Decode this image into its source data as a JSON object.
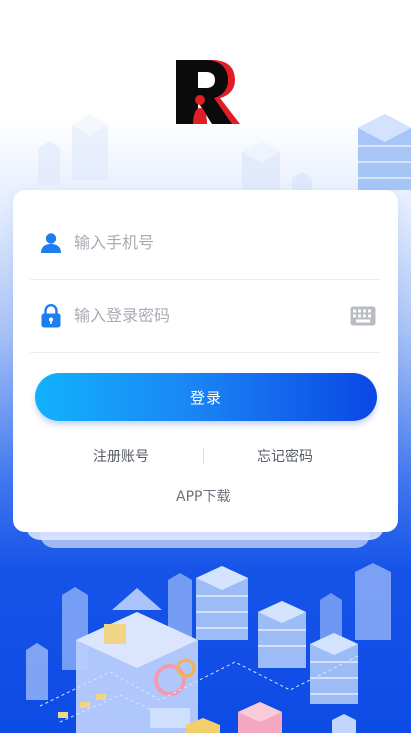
{
  "logo": {
    "name": "app-logo"
  },
  "form": {
    "phone_placeholder": "输入手机号",
    "password_placeholder": "输入登录密码",
    "login_label": "登录",
    "register_label": "注册账号",
    "forgot_label": "忘记密码",
    "app_download_label": "APP下载"
  },
  "icons": {
    "phone_field": "user-icon",
    "password_field": "lock-icon",
    "keyboard": "keyboard-icon"
  },
  "colors": {
    "accent": "#1a86f5",
    "button_start": "#11b2fc",
    "button_end": "#0b47e4",
    "background_bottom": "#0d4be6"
  }
}
